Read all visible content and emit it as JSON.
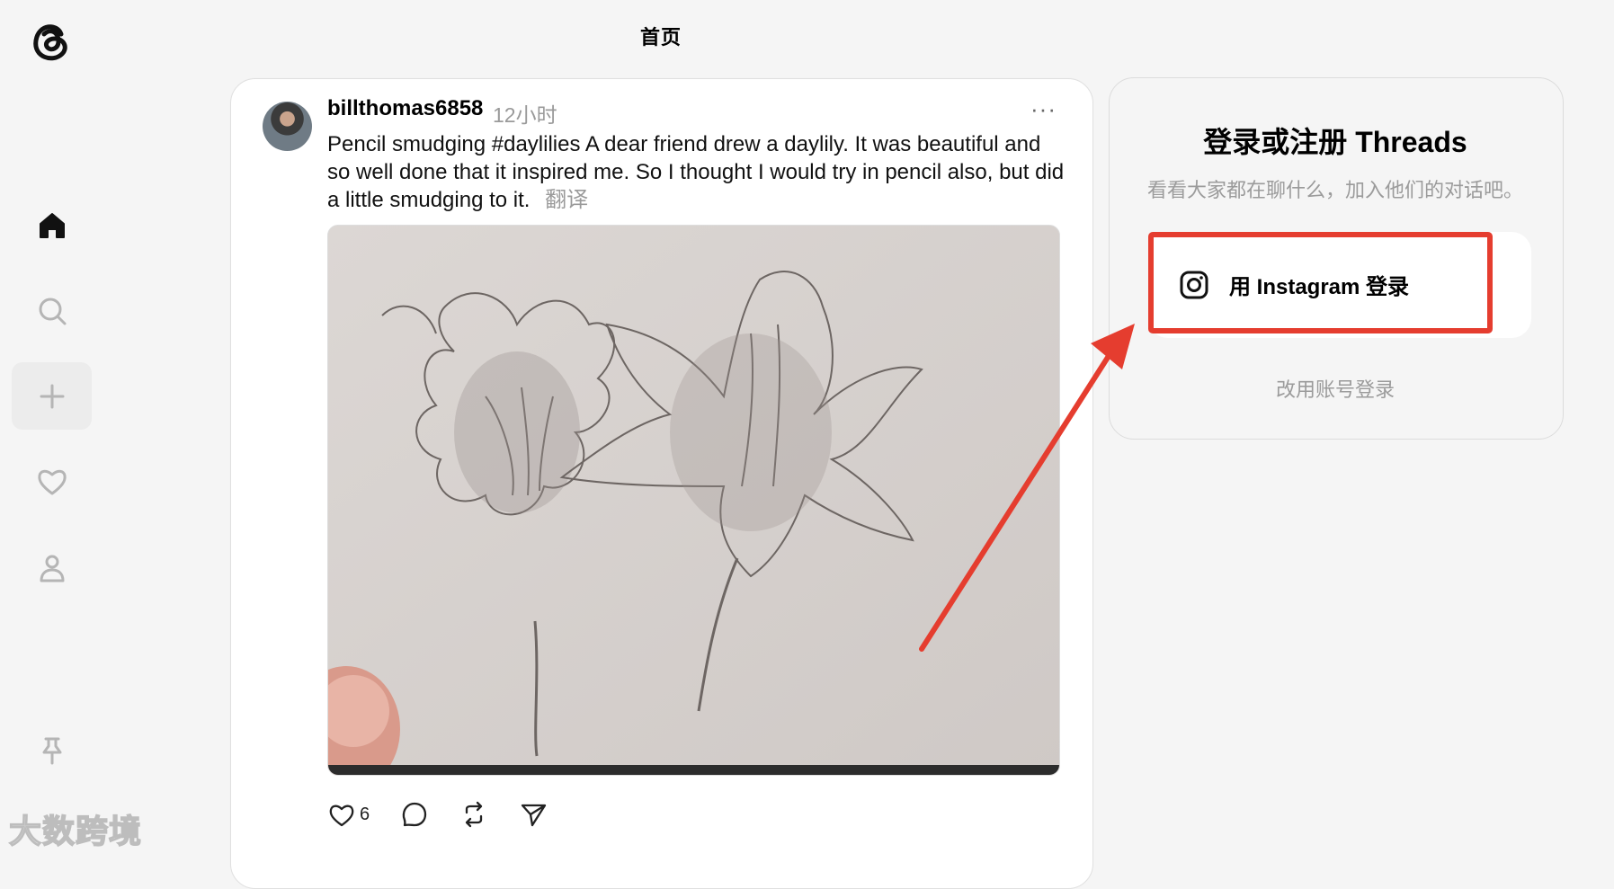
{
  "header": {
    "title": "首页"
  },
  "nav": {
    "items": [
      {
        "name": "home",
        "icon": "home-icon"
      },
      {
        "name": "search",
        "icon": "search-icon"
      },
      {
        "name": "create",
        "icon": "plus-icon"
      },
      {
        "name": "activity",
        "icon": "heart-icon"
      },
      {
        "name": "profile",
        "icon": "person-icon"
      },
      {
        "name": "pinned",
        "icon": "pin-icon"
      }
    ]
  },
  "post": {
    "username": "billthomas6858",
    "time": "12小时",
    "more": "···",
    "text": "Pencil smudging #daylilies A dear friend drew a daylily. It was beautiful and so well done that it inspired me. So I thought I would try in pencil also, but did a little smudging to it.",
    "translate_label": "翻译",
    "likes": "6"
  },
  "login": {
    "title": "登录或注册 Threads",
    "subtitle": "看看大家都在聊什么，加入他们的对话吧。",
    "instagram_button": "用 Instagram 登录",
    "alt_login": "改用账号登录"
  },
  "watermark": "大数跨境",
  "colors": {
    "annotation_red": "#e53d2f",
    "muted_text": "#9b9b9b"
  }
}
